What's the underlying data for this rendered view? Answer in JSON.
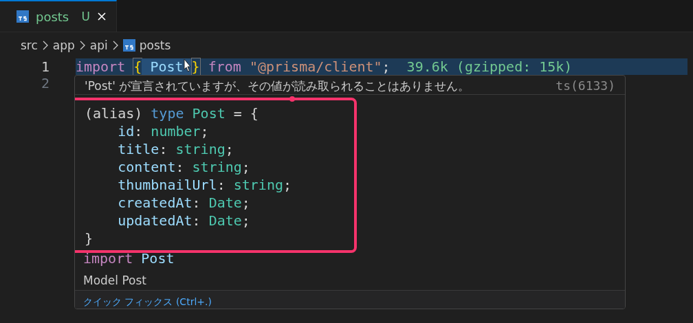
{
  "tabs": [
    {
      "label": "posts",
      "status": "U",
      "selected": true
    }
  ],
  "breadcrumbs": [
    {
      "label": "src",
      "kind": "folder"
    },
    {
      "label": "app",
      "kind": "folder"
    },
    {
      "label": "api",
      "kind": "folder"
    },
    {
      "label": "posts",
      "kind": "file"
    }
  ],
  "editor": {
    "lines": [
      {
        "number": "1",
        "tokens": [
          {
            "text": "import ",
            "kind": "keyword"
          },
          {
            "text": "{",
            "kind": "bracket"
          },
          {
            "text": " Post ",
            "kind": "ident"
          },
          {
            "text": "}",
            "kind": "bracket"
          },
          {
            "text": " from ",
            "kind": "keyword"
          },
          {
            "text": "\"@prisma/client\"",
            "kind": "string"
          },
          {
            "text": ";",
            "kind": "plain"
          }
        ],
        "annotation": "39.6k (gzipped: 15k)",
        "selected": true
      },
      {
        "number": "2",
        "selected": false
      }
    ]
  },
  "hover": {
    "message": "'Post' が宣言されていますが、その値が読み取られることはありません。",
    "code": "ts(6133)",
    "signature": [
      [
        {
          "text": "(alias) ",
          "kind": "plain"
        },
        {
          "text": "type ",
          "kind": "type-keyword"
        },
        {
          "text": "Post",
          "kind": "type"
        },
        {
          "text": " = {",
          "kind": "plain"
        }
      ],
      [
        {
          "text": "    id",
          "kind": "prop"
        },
        {
          "text": ": ",
          "kind": "plain"
        },
        {
          "text": "number",
          "kind": "type"
        },
        {
          "text": ";",
          "kind": "plain"
        }
      ],
      [
        {
          "text": "    title",
          "kind": "prop"
        },
        {
          "text": ": ",
          "kind": "plain"
        },
        {
          "text": "string",
          "kind": "type"
        },
        {
          "text": ";",
          "kind": "plain"
        }
      ],
      [
        {
          "text": "    content",
          "kind": "prop"
        },
        {
          "text": ": ",
          "kind": "plain"
        },
        {
          "text": "string",
          "kind": "type"
        },
        {
          "text": ";",
          "kind": "plain"
        }
      ],
      [
        {
          "text": "    thumbnailUrl",
          "kind": "prop"
        },
        {
          "text": ": ",
          "kind": "plain"
        },
        {
          "text": "string",
          "kind": "type"
        },
        {
          "text": ";",
          "kind": "plain"
        }
      ],
      [
        {
          "text": "    createdAt",
          "kind": "prop"
        },
        {
          "text": ": ",
          "kind": "plain"
        },
        {
          "text": "Date",
          "kind": "type"
        },
        {
          "text": ";",
          "kind": "plain"
        }
      ],
      [
        {
          "text": "    updatedAt",
          "kind": "prop"
        },
        {
          "text": ": ",
          "kind": "plain"
        },
        {
          "text": "Date",
          "kind": "type"
        },
        {
          "text": ";",
          "kind": "plain"
        }
      ],
      [
        {
          "text": "}",
          "kind": "plain"
        }
      ]
    ],
    "import_line": [
      {
        "text": "import ",
        "kind": "keyword"
      },
      {
        "text": "Post",
        "kind": "ident"
      }
    ],
    "doc": "Model Post",
    "quick_fix": "クイック フィックス (Ctrl+.)"
  }
}
